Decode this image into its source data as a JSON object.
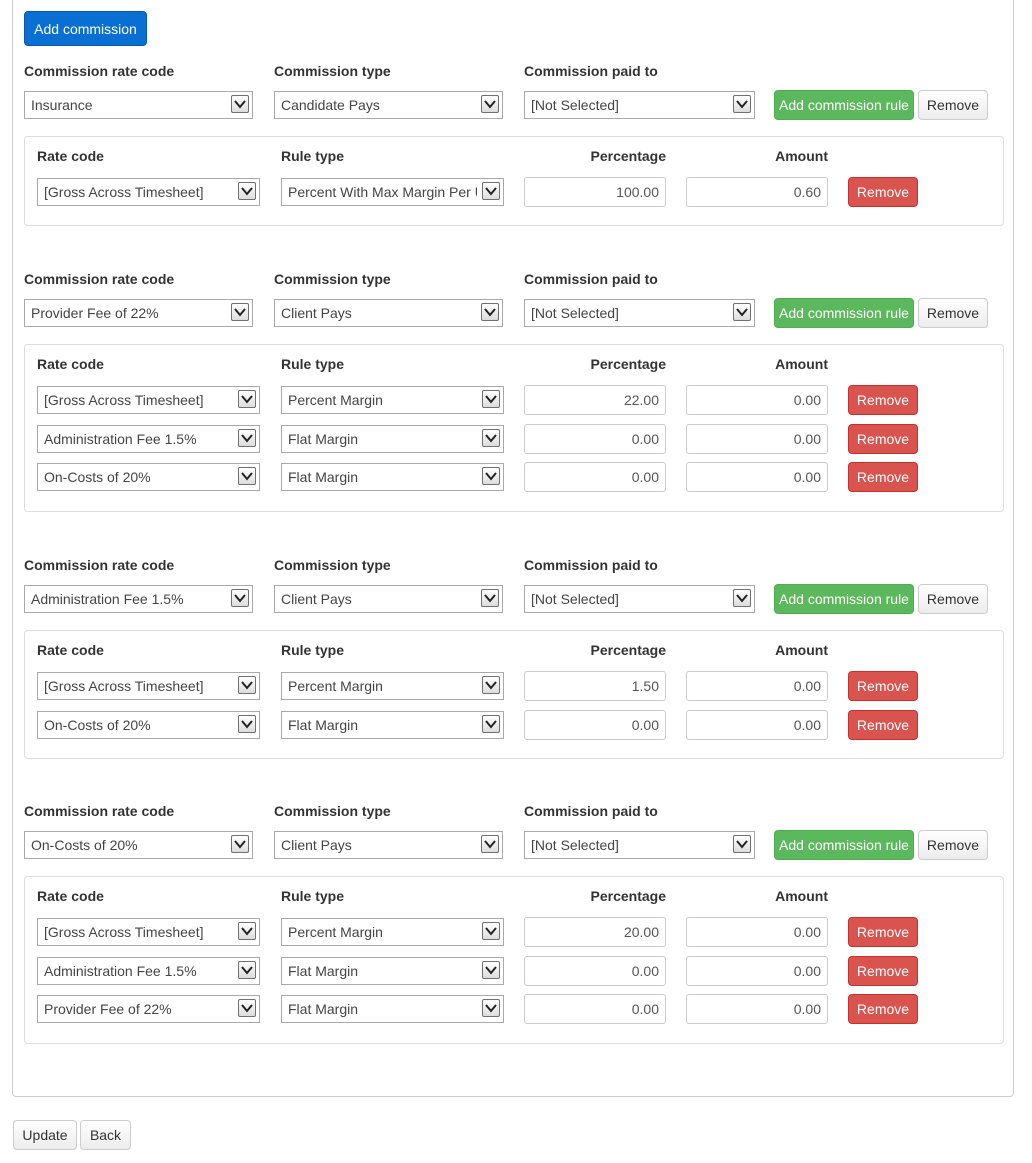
{
  "toolbar": {
    "add_commission_label": "Add commission"
  },
  "labels": {
    "commission_rate_code": "Commission rate code",
    "commission_type": "Commission type",
    "commission_paid_to": "Commission paid to",
    "rate_code": "Rate code",
    "rule_type": "Rule type",
    "percentage": "Percentage",
    "amount": "Amount",
    "add_commission_rule": "Add commission rule",
    "remove": "Remove"
  },
  "commissions": [
    {
      "rate_code": "Insurance",
      "type": "Candidate Pays",
      "paid_to": "[Not Selected]",
      "rules": [
        {
          "rate_code": "[Gross Across Timesheet]",
          "rule_type": "Percent With Max Margin Per Unit",
          "percentage": "100.00",
          "amount": "0.60"
        }
      ]
    },
    {
      "rate_code": "Provider Fee of 22%",
      "type": "Client Pays",
      "paid_to": "[Not Selected]",
      "rules": [
        {
          "rate_code": "[Gross Across Timesheet]",
          "rule_type": "Percent Margin",
          "percentage": "22.00",
          "amount": "0.00"
        },
        {
          "rate_code": "Administration Fee 1.5%",
          "rule_type": "Flat Margin",
          "percentage": "0.00",
          "amount": "0.00"
        },
        {
          "rate_code": "On-Costs of 20%",
          "rule_type": "Flat Margin",
          "percentage": "0.00",
          "amount": "0.00"
        }
      ]
    },
    {
      "rate_code": "Administration Fee 1.5%",
      "type": "Client Pays",
      "paid_to": "[Not Selected]",
      "rules": [
        {
          "rate_code": "[Gross Across Timesheet]",
          "rule_type": "Percent Margin",
          "percentage": "1.50",
          "amount": "0.00"
        },
        {
          "rate_code": "On-Costs of 20%",
          "rule_type": "Flat Margin",
          "percentage": "0.00",
          "amount": "0.00"
        }
      ]
    },
    {
      "rate_code": "On-Costs of 20%",
      "type": "Client Pays",
      "paid_to": "[Not Selected]",
      "rules": [
        {
          "rate_code": "[Gross Across Timesheet]",
          "rule_type": "Percent Margin",
          "percentage": "20.00",
          "amount": "0.00"
        },
        {
          "rate_code": "Administration Fee 1.5%",
          "rule_type": "Flat Margin",
          "percentage": "0.00",
          "amount": "0.00"
        },
        {
          "rate_code": "Provider Fee of 22%",
          "rule_type": "Flat Margin",
          "percentage": "0.00",
          "amount": "0.00"
        }
      ]
    }
  ],
  "footer": {
    "update_label": "Update",
    "back_label": "Back"
  },
  "colors": {
    "primary": "#0a6fd3",
    "success": "#5cb85c",
    "danger": "#d9534f",
    "border": "#cccccc"
  },
  "icons": {
    "select_arrow": "chevron-down-icon"
  }
}
